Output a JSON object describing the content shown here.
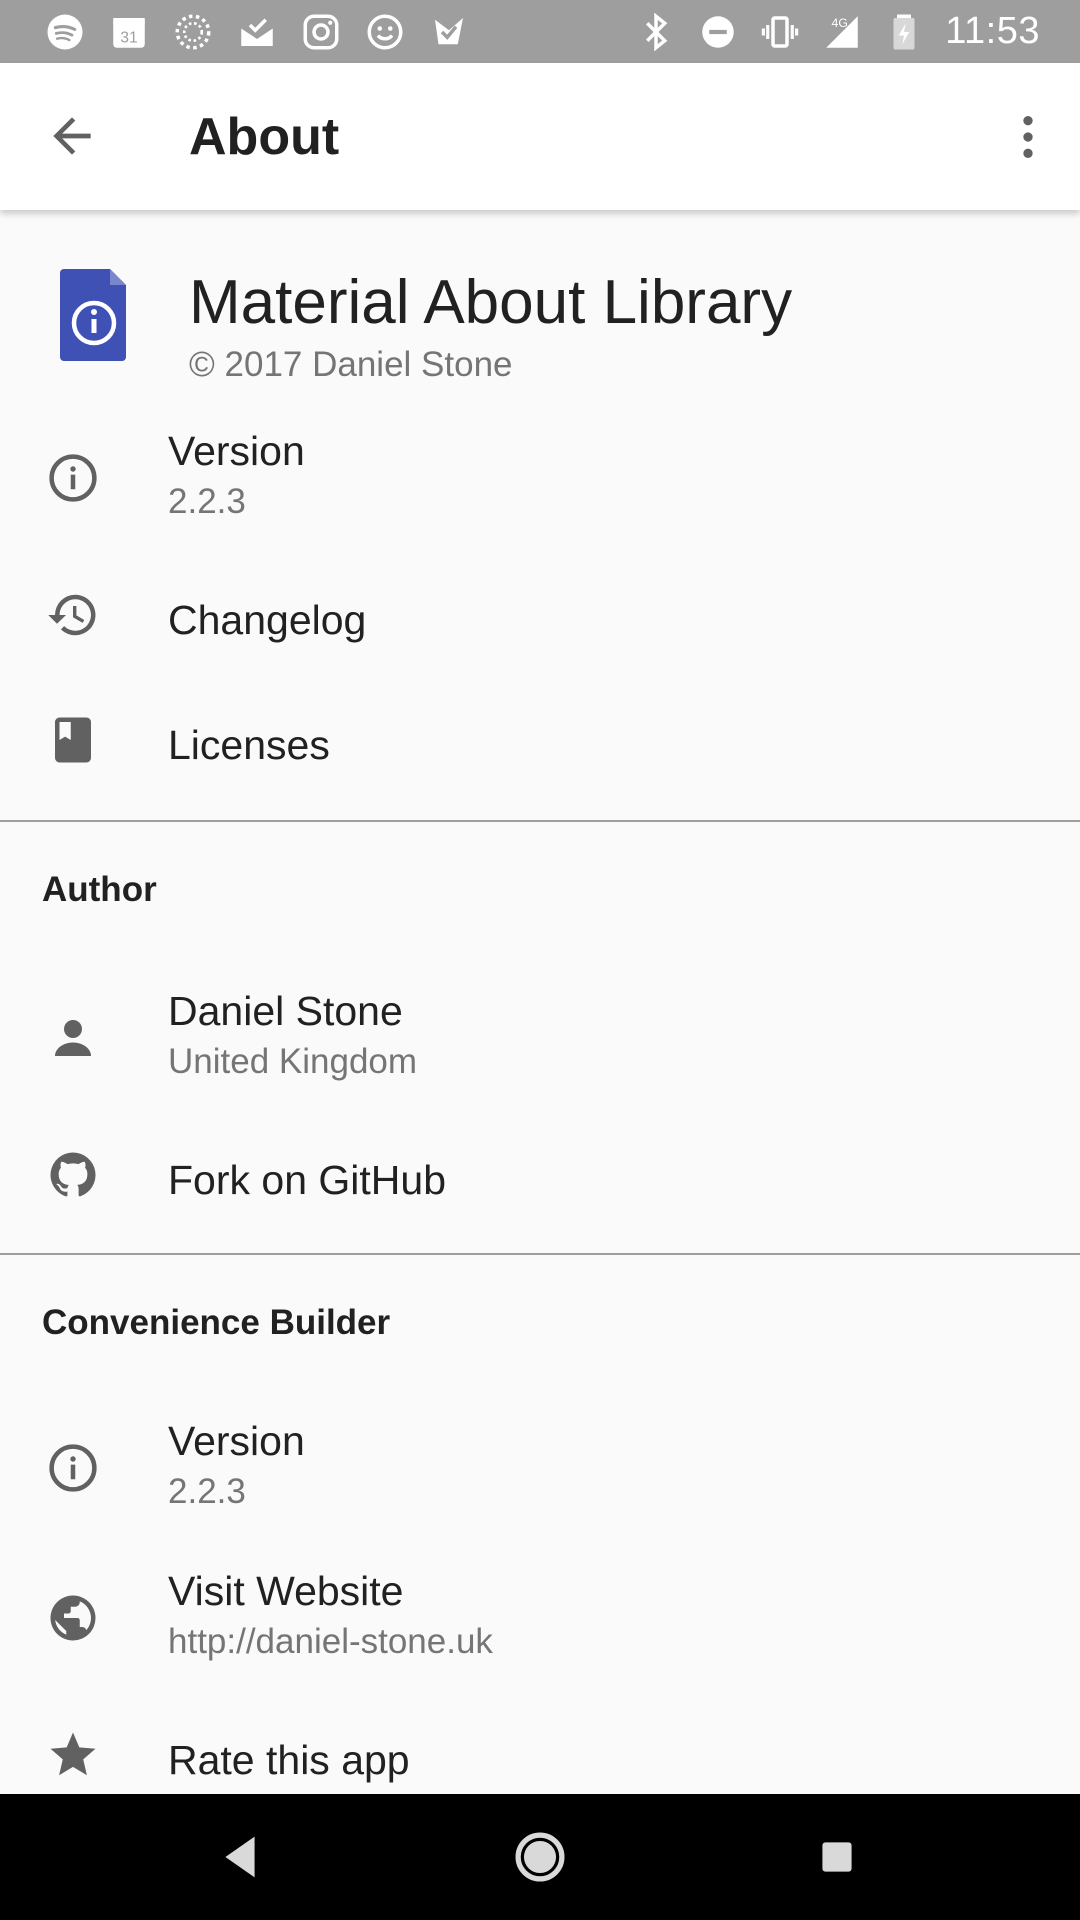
{
  "status_bar": {
    "time": "11:53",
    "calendar_day": "31",
    "network": "4G",
    "left_icons": [
      "spotify-icon",
      "calendar-icon",
      "loading-icon",
      "mail-check-icon",
      "instagram-icon",
      "smiley-icon",
      "task-icon"
    ],
    "right_icons": [
      "bluetooth-icon",
      "do-not-disturb-icon",
      "vibrate-icon",
      "signal-icon",
      "battery-icon"
    ]
  },
  "app_bar": {
    "title": "About",
    "back_icon": "arrow-back-icon",
    "menu_icon": "more-vert-icon"
  },
  "app_card": {
    "name": "Material About Library",
    "copyright": "© 2017 Daniel Stone",
    "logo_color": "#3f51b5"
  },
  "main_items": [
    {
      "icon": "info-icon",
      "title": "Version",
      "subtitle": "2.2.3"
    },
    {
      "icon": "history-icon",
      "title": "Changelog"
    },
    {
      "icon": "book-icon",
      "title": "Licenses"
    }
  ],
  "author_section": {
    "title": "Author",
    "items": [
      {
        "icon": "person-icon",
        "title": "Daniel Stone",
        "subtitle": "United Kingdom"
      },
      {
        "icon": "github-icon",
        "title": "Fork on GitHub"
      }
    ]
  },
  "builder_section": {
    "title": "Convenience Builder",
    "items": [
      {
        "icon": "info-icon",
        "title": "Version",
        "subtitle": "2.2.3"
      },
      {
        "icon": "globe-icon",
        "title": "Visit Website",
        "subtitle": "http://daniel-stone.uk"
      },
      {
        "icon": "star-icon",
        "title": "Rate this app"
      }
    ]
  },
  "nav_bar": {
    "back": "nav-back-icon",
    "home": "nav-home-icon",
    "recents": "nav-recents-icon"
  }
}
